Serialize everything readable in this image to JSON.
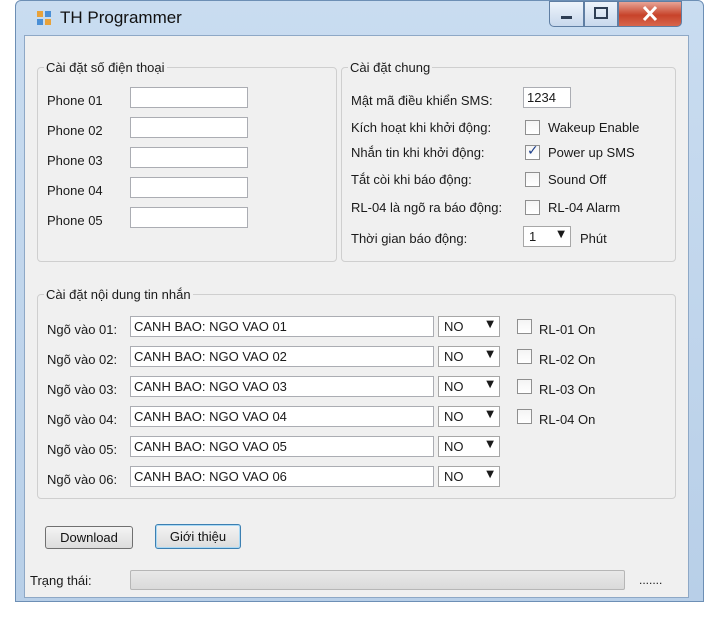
{
  "window": {
    "title": "TH Programmer"
  },
  "phone_group": {
    "legend": "Cài đặt số điện thoại",
    "rows": [
      {
        "label": "Phone 01",
        "value": ""
      },
      {
        "label": "Phone 02",
        "value": ""
      },
      {
        "label": "Phone 03",
        "value": ""
      },
      {
        "label": "Phone 04",
        "value": ""
      },
      {
        "label": "Phone 05",
        "value": ""
      }
    ]
  },
  "general_group": {
    "legend": "Cài đặt chung",
    "sms_code_label": "Mật mã điều khiển SMS:",
    "sms_code_value": "1234",
    "options": [
      {
        "label": "Kích hoạt khi khởi động:",
        "check_label": "Wakeup Enable",
        "checked": false
      },
      {
        "label": "Nhắn tin khi khởi động:",
        "check_label": "Power up SMS",
        "checked": true
      },
      {
        "label": "Tắt còi khi báo động:",
        "check_label": "Sound Off",
        "checked": false
      },
      {
        "label": "RL-04 là ngõ ra báo động:",
        "check_label": "RL-04 Alarm",
        "checked": false
      }
    ],
    "alarm_time_label": "Thời gian báo động:",
    "alarm_time_value": "1",
    "alarm_time_unit": "Phút"
  },
  "message_group": {
    "legend": "Cài đặt nội dung tin nhắn",
    "rows": [
      {
        "label": "Ngõ vào 01:",
        "text": "CANH BAO: NGO VAO 01",
        "mode": "NO",
        "relay": "RL-01 On",
        "relay_checked": false
      },
      {
        "label": "Ngõ vào 02:",
        "text": "CANH BAO: NGO VAO 02",
        "mode": "NO",
        "relay": "RL-02 On",
        "relay_checked": false
      },
      {
        "label": "Ngõ vào 03:",
        "text": "CANH BAO: NGO VAO 03",
        "mode": "NO",
        "relay": "RL-03 On",
        "relay_checked": false
      },
      {
        "label": "Ngõ vào 04:",
        "text": "CANH BAO: NGO VAO 04",
        "mode": "NO",
        "relay": "RL-04 On",
        "relay_checked": false
      },
      {
        "label": "Ngõ vào 05:",
        "text": "CANH BAO: NGO VAO 05",
        "mode": "NO"
      },
      {
        "label": "Ngõ vào 06:",
        "text": "CANH BAO: NGO VAO 06",
        "mode": "NO"
      }
    ]
  },
  "buttons": {
    "download": "Download",
    "about": "Giới thiệu"
  },
  "status": {
    "label": "Trạng thái:",
    "dots": ".......",
    "progress": 0
  },
  "colors": {
    "title_bar": "#c9dcf0",
    "close_button": "#c7432a",
    "client_bg": "#f0f0f0"
  }
}
